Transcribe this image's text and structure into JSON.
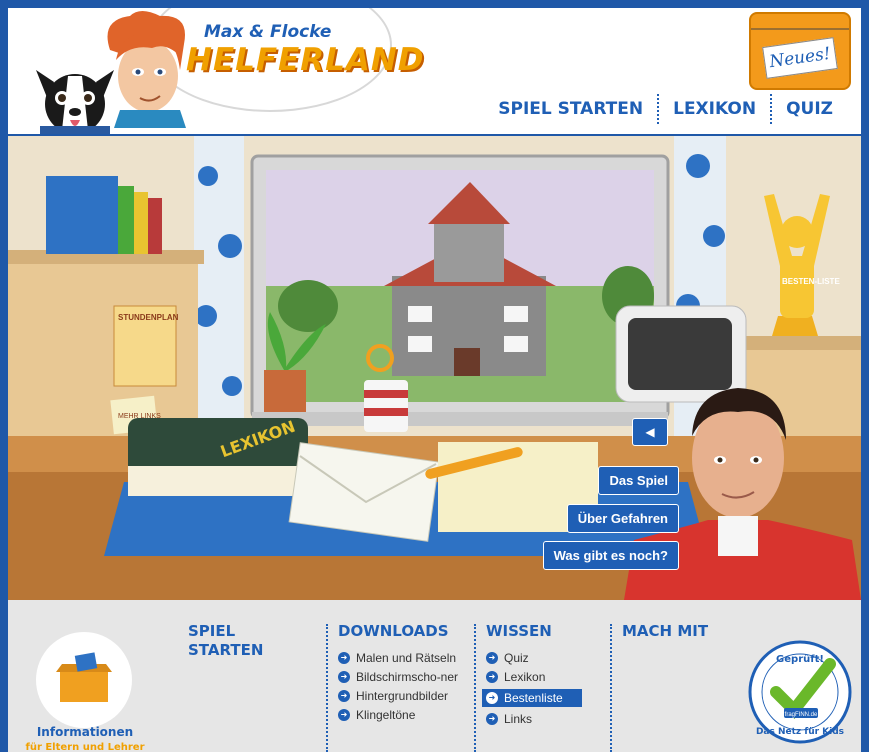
{
  "header": {
    "logo_small": "Max & Flocke",
    "logo_big": "HELFERLAND",
    "news_label": "Neues!",
    "nav": [
      "SPIEL STARTEN",
      "LEXIKON",
      "QUIZ"
    ]
  },
  "scene": {
    "timetable_label": "STUNDENPLAN",
    "note_label": "MEHR LINKS",
    "book_label": "LEXIKON",
    "trophy_label": "BESTEN-LISTE",
    "buttons": {
      "spiel": "Das Spiel",
      "gefahren": "Über Gefahren",
      "noch": "Was gibt es noch?"
    }
  },
  "footer": {
    "info_title": "Informationen",
    "info_sub": "für Eltern und Lehrer",
    "columns": [
      {
        "title": "SPIEL STARTEN",
        "items": []
      },
      {
        "title": "DOWNLOADS",
        "items": [
          "Malen und Rätseln",
          "Bildschirmscho-ner",
          "Hintergrundbilder",
          "Klingeltöne"
        ]
      },
      {
        "title": "WISSEN",
        "items": [
          "Quiz",
          "Lexikon",
          "Bestenliste",
          "Links"
        ],
        "active_index": 2
      },
      {
        "title": "MACH MIT",
        "items": []
      }
    ],
    "seal": {
      "top": "Geprüft!",
      "mid": "fragFINN.de",
      "bottom": "Das Netz für Kids"
    }
  },
  "colors": {
    "brand_blue": "#1f5fb5",
    "orange": "#f0a000",
    "frame": "#1f58a8"
  }
}
